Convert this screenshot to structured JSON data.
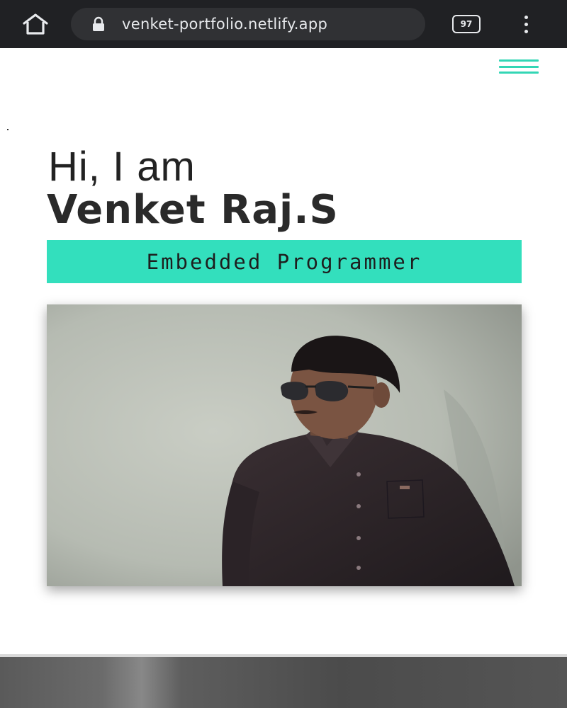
{
  "browser": {
    "url": "venket-portfolio.netlify.app",
    "tab_count": "97",
    "icons": {
      "home": "home-icon",
      "lock": "lock-icon",
      "menu": "more-vertical-icon"
    }
  },
  "page": {
    "menu_icon": "hamburger-menu-icon",
    "greeting": "Hi, I am",
    "name": "Venket Raj.S",
    "role": "Embedded Programmer",
    "photo_alt": "profile-photo",
    "colors": {
      "accent": "#33dfbd",
      "hamburger": "#33d6b5",
      "text_dark": "#2a2a2a",
      "browser_bar": "#202124"
    }
  }
}
